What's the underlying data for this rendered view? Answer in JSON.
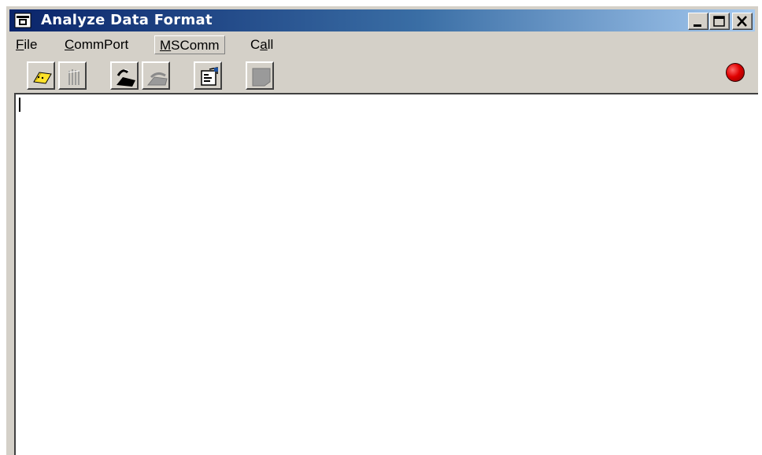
{
  "window": {
    "title": "Analyze Data Format",
    "title_icon": "telephone-icon",
    "controls": [
      "minimize-icon",
      "maximize-icon",
      "close-icon"
    ]
  },
  "menu": {
    "items": [
      {
        "label": "File",
        "mnemonic": "F"
      },
      {
        "label": "CommPort",
        "mnemonic": "C"
      },
      {
        "label": "MSComm",
        "mnemonic": "M",
        "active": true
      },
      {
        "label": "Call",
        "mnemonic": "a"
      }
    ]
  },
  "toolbar": {
    "buttons": [
      {
        "icon": "open-port-icon",
        "enabled": true
      },
      {
        "icon": "close-port-icon",
        "enabled": false
      },
      {
        "icon": "dial-phone-icon",
        "enabled": true
      },
      {
        "icon": "hangup-phone-icon",
        "enabled": false
      },
      {
        "icon": "properties-icon",
        "enabled": true
      },
      {
        "icon": "clear-icon",
        "enabled": false
      }
    ]
  },
  "status": {
    "indicator_icon": "connection-status-led",
    "indicator_color": "#e00000"
  },
  "editor": {
    "text": ""
  },
  "colors": {
    "titlebar_start": "#0a246a",
    "titlebar_end": "#a6caf0",
    "face": "#d4d0c8"
  }
}
